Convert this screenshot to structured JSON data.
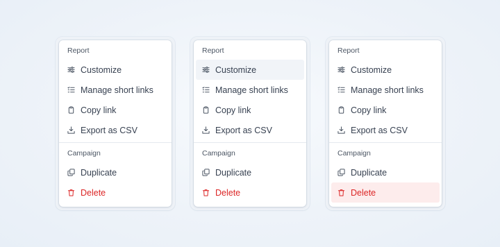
{
  "menus": [
    {
      "report_label": "Report",
      "items": [
        {
          "label": "Customize",
          "icon": "sliders-icon"
        },
        {
          "label": "Manage short links",
          "icon": "list-check-icon"
        },
        {
          "label": "Copy link",
          "icon": "clipboard-icon"
        },
        {
          "label": "Export as CSV",
          "icon": "download-tray-icon"
        }
      ],
      "campaign_label": "Campaign",
      "campaign_items": [
        {
          "label": "Duplicate",
          "icon": "copy-icon"
        },
        {
          "label": "Delete",
          "icon": "trash-icon"
        }
      ],
      "state": "default"
    },
    {
      "report_label": "Report",
      "items": [
        {
          "label": "Customize",
          "icon": "sliders-icon"
        },
        {
          "label": "Manage short links",
          "icon": "list-check-icon"
        },
        {
          "label": "Copy link",
          "icon": "clipboard-icon"
        },
        {
          "label": "Export as CSV",
          "icon": "download-tray-icon"
        }
      ],
      "campaign_label": "Campaign",
      "campaign_items": [
        {
          "label": "Duplicate",
          "icon": "copy-icon"
        },
        {
          "label": "Delete",
          "icon": "trash-icon"
        }
      ],
      "state": "hover-customize"
    },
    {
      "report_label": "Report",
      "items": [
        {
          "label": "Customize",
          "icon": "sliders-icon"
        },
        {
          "label": "Manage short links",
          "icon": "list-check-icon"
        },
        {
          "label": "Copy link",
          "icon": "clipboard-icon"
        },
        {
          "label": "Export as CSV",
          "icon": "download-tray-icon"
        }
      ],
      "campaign_label": "Campaign",
      "campaign_items": [
        {
          "label": "Duplicate",
          "icon": "copy-icon"
        },
        {
          "label": "Delete",
          "icon": "trash-icon"
        }
      ],
      "state": "hover-delete"
    }
  ],
  "colors": {
    "danger": "#dc2626",
    "hover_bg": "#f1f4f8",
    "danger_hover_bg": "#fdecec"
  }
}
